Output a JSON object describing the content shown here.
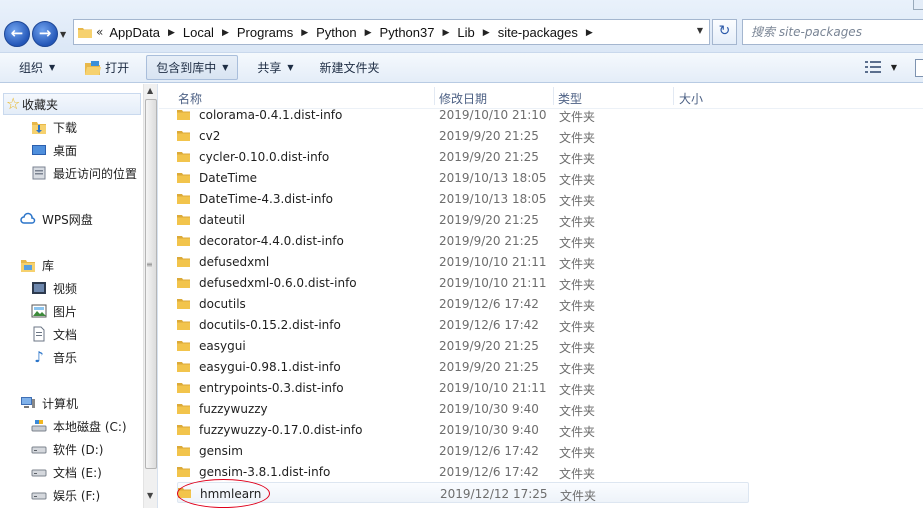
{
  "address": {
    "lead": "«",
    "crumbs": [
      "AppData",
      "Local",
      "Programs",
      "Python",
      "Python37",
      "Lib",
      "site-packages"
    ],
    "search_placeholder": "搜索 site-packages"
  },
  "toolbar": {
    "organize": "组织",
    "open": "打开",
    "include_library": "包含到库中",
    "share": "共享",
    "new_folder": "新建文件夹"
  },
  "nav": {
    "favorites": "收藏夹",
    "downloads": "下载",
    "desktop": "桌面",
    "recent": "最近访问的位置",
    "wps": "WPS网盘",
    "libraries": "库",
    "videos": "视频",
    "pictures": "图片",
    "documents": "文档",
    "music": "音乐",
    "computer": "计算机",
    "drive_c": "本地磁盘 (C:)",
    "drive_d": "软件 (D:)",
    "drive_e": "文档 (E:)",
    "drive_f": "娱乐 (F:)"
  },
  "columns": {
    "name": "名称",
    "modified": "修改日期",
    "type": "类型",
    "size": "大小"
  },
  "files": [
    {
      "name": "colorama-0.4.1.dist-info",
      "date": "2019/10/10 21:10",
      "type": "文件夹"
    },
    {
      "name": "cv2",
      "date": "2019/9/20 21:25",
      "type": "文件夹"
    },
    {
      "name": "cycler-0.10.0.dist-info",
      "date": "2019/9/20 21:25",
      "type": "文件夹"
    },
    {
      "name": "DateTime",
      "date": "2019/10/13 18:05",
      "type": "文件夹"
    },
    {
      "name": "DateTime-4.3.dist-info",
      "date": "2019/10/13 18:05",
      "type": "文件夹"
    },
    {
      "name": "dateutil",
      "date": "2019/9/20 21:25",
      "type": "文件夹"
    },
    {
      "name": "decorator-4.4.0.dist-info",
      "date": "2019/9/20 21:25",
      "type": "文件夹"
    },
    {
      "name": "defusedxml",
      "date": "2019/10/10 21:11",
      "type": "文件夹"
    },
    {
      "name": "defusedxml-0.6.0.dist-info",
      "date": "2019/10/10 21:11",
      "type": "文件夹"
    },
    {
      "name": "docutils",
      "date": "2019/12/6 17:42",
      "type": "文件夹"
    },
    {
      "name": "docutils-0.15.2.dist-info",
      "date": "2019/12/6 17:42",
      "type": "文件夹"
    },
    {
      "name": "easygui",
      "date": "2019/9/20 21:25",
      "type": "文件夹"
    },
    {
      "name": "easygui-0.98.1.dist-info",
      "date": "2019/9/20 21:25",
      "type": "文件夹"
    },
    {
      "name": "entrypoints-0.3.dist-info",
      "date": "2019/10/10 21:11",
      "type": "文件夹"
    },
    {
      "name": "fuzzywuzzy",
      "date": "2019/10/30 9:40",
      "type": "文件夹"
    },
    {
      "name": "fuzzywuzzy-0.17.0.dist-info",
      "date": "2019/10/30 9:40",
      "type": "文件夹"
    },
    {
      "name": "gensim",
      "date": "2019/12/6 17:42",
      "type": "文件夹"
    },
    {
      "name": "gensim-3.8.1.dist-info",
      "date": "2019/12/6 17:42",
      "type": "文件夹"
    },
    {
      "name": "hmmlearn",
      "date": "2019/12/12 17:25",
      "type": "文件夹"
    }
  ],
  "colors": {
    "folder": "#f2c44c",
    "accent": "#2457b8",
    "highlight_circle": "#e0001b"
  }
}
